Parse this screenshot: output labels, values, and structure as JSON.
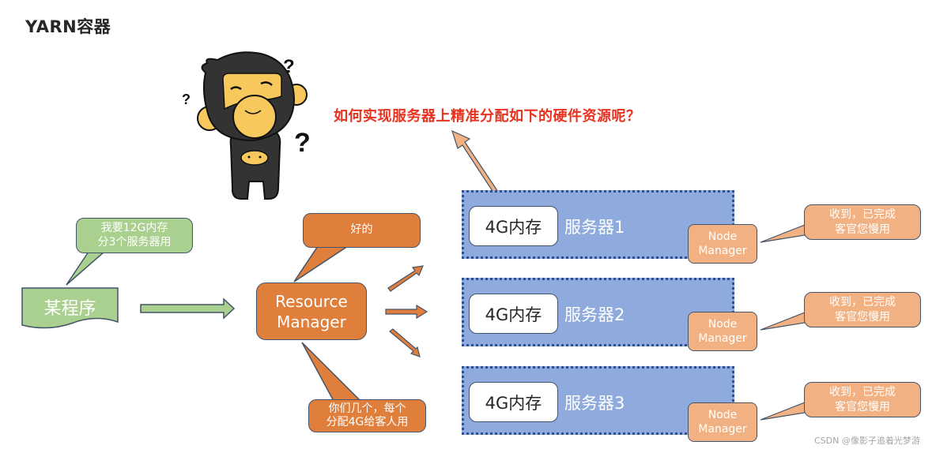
{
  "title": "YARN容器",
  "question": "如何实现服务器上精准分配如下的硬件资源呢？",
  "mascot": {
    "name": "confused-monkey",
    "question_marks": [
      "?",
      "?",
      "?"
    ]
  },
  "program": {
    "label": "某程序",
    "bubble_line1": "我要12G内存",
    "bubble_line2": "分3个服务器用"
  },
  "resource_manager": {
    "line1": "Resource",
    "line2": "Manager",
    "reply": "好的",
    "instruction_line1": "你们几个，每个",
    "instruction_line2": "分配4G给客人用"
  },
  "servers": [
    {
      "memory": "4G内存",
      "name": "服务器1",
      "nm_line1": "Node",
      "nm_line2": "Manager",
      "reply_line1": "收到，已完成",
      "reply_line2": "客官您慢用"
    },
    {
      "memory": "4G内存",
      "name": "服务器2",
      "nm_line1": "Node",
      "nm_line2": "Manager",
      "reply_line1": "收到，已完成",
      "reply_line2": "客官您慢用"
    },
    {
      "memory": "4G内存",
      "name": "服务器3",
      "nm_line1": "Node",
      "nm_line2": "Manager",
      "reply_line1": "收到，已完成",
      "reply_line2": "客官您慢用"
    }
  ],
  "colors": {
    "question": "#e8321f",
    "green": "#a9d08e",
    "orange": "#e07f3c",
    "light_orange": "#f2b183",
    "server_blue": "#8faadc",
    "outline": "#44546a"
  },
  "watermark": "CSDN @像影子追着光梦游"
}
